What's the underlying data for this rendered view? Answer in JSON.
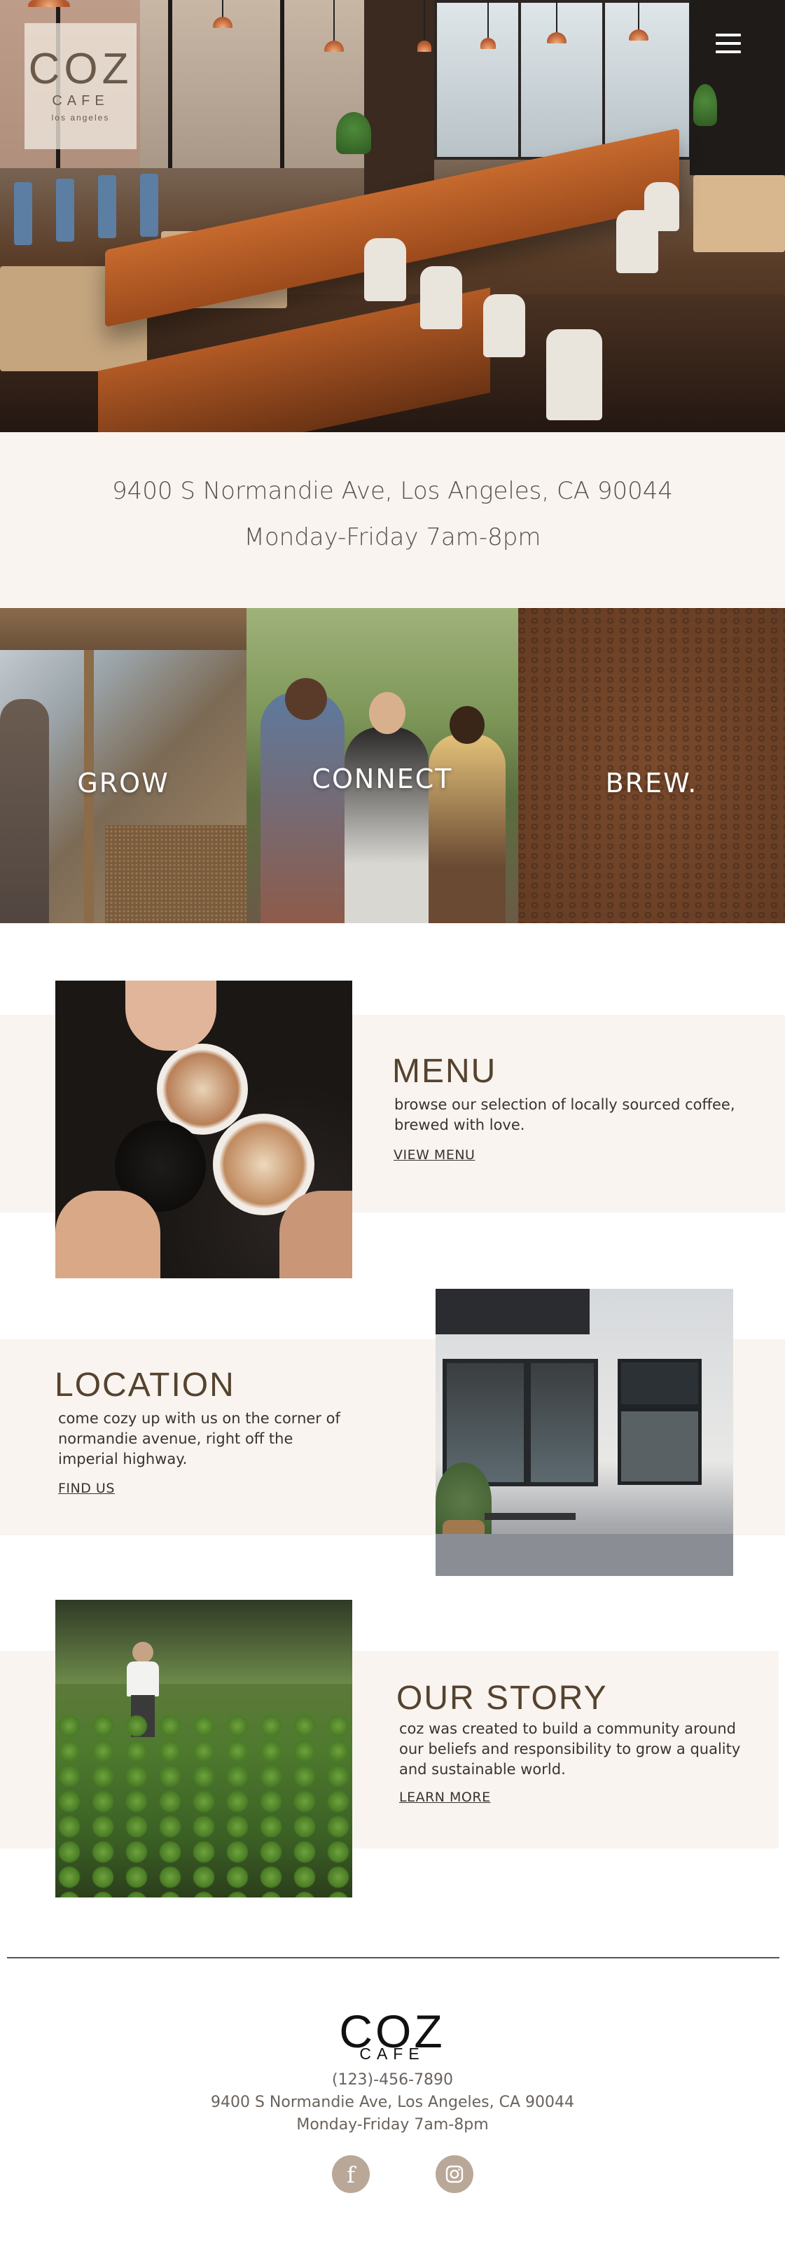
{
  "header": {
    "logo": {
      "name": "COZ",
      "subtitle": "CAFE",
      "location": "los angeles"
    },
    "menu_icon": "hamburger-menu-icon"
  },
  "info": {
    "address": "9400 S Normandie Ave, Los Angeles, CA 90044",
    "hours": "Monday-Friday 7am-8pm"
  },
  "tiles": [
    {
      "label": "GROW"
    },
    {
      "label": "CONNECT"
    },
    {
      "label": "BREW."
    }
  ],
  "sections": {
    "menu": {
      "title": "MENU",
      "text": "browse our selection of locally sourced coffee, brewed with love.",
      "link": "VIEW MENU"
    },
    "location": {
      "title": "LOCATION",
      "text": "come cozy up with us on the corner of normandie avenue, right off the imperial highway.",
      "link": "FIND US"
    },
    "story": {
      "title": "OUR STORY",
      "text": "coz was created to build a community around our beliefs and responsibility to grow a quality and sustainable world.",
      "link": "LEARN MORE"
    }
  },
  "footer": {
    "logo": {
      "name": "COZ",
      "subtitle": "CAFE"
    },
    "phone": "(123)-456-7890",
    "address": "9400 S Normandie Ave, Los Angeles, CA 90044",
    "hours": "Monday-Friday 7am-8pm",
    "social": [
      {
        "icon": "facebook-icon",
        "glyph": "f"
      },
      {
        "icon": "instagram-icon"
      }
    ]
  },
  "colors": {
    "band": "#f9f4ef",
    "heading": "#55432f",
    "social_bg": "#b9a898"
  }
}
